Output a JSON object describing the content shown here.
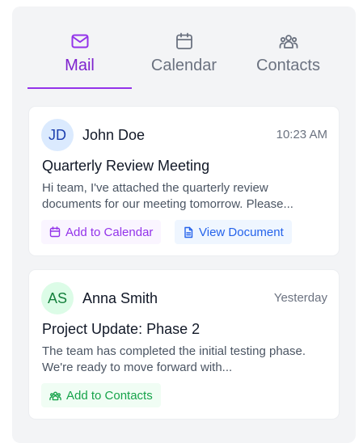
{
  "tabs": [
    {
      "label": "Mail",
      "icon": "mail-icon",
      "active": true
    },
    {
      "label": "Calendar",
      "icon": "calendar-icon",
      "active": false
    },
    {
      "label": "Contacts",
      "icon": "contacts-icon",
      "active": false
    }
  ],
  "messages": [
    {
      "initials": "JD",
      "sender": "John Doe",
      "time": "10:23 AM",
      "subject": "Quarterly Review Meeting",
      "preview_line1": "Hi team, I've attached the quarterly review",
      "preview_line2": "documents for our meeting tomorrow. Please...",
      "actions": [
        {
          "label": "Add to Calendar",
          "icon": "calendar-icon"
        },
        {
          "label": "View Document",
          "icon": "document-icon"
        }
      ]
    },
    {
      "initials": "AS",
      "sender": "Anna Smith",
      "time": "Yesterday",
      "subject": "Project Update: Phase 2",
      "preview_line1": "The team has completed the initial testing phase.",
      "preview_line2": "We're ready to move forward with...",
      "actions": [
        {
          "label": "Add to Contacts",
          "icon": "contacts-icon"
        }
      ]
    }
  ],
  "colors": {
    "accent": "#9333ea",
    "blue": "#2563eb",
    "green": "#16a34a"
  }
}
